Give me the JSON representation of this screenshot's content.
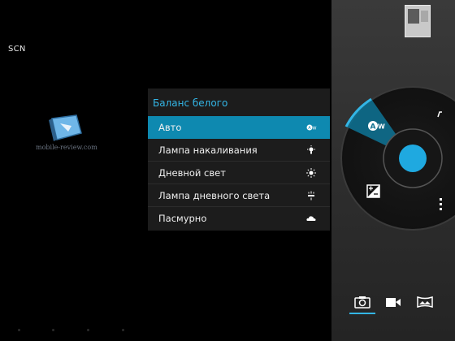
{
  "viewfinder": {
    "scene_label": "SCN",
    "watermark_text": "mobile-review.com"
  },
  "white_balance": {
    "title": "Баланс белого",
    "selected_index": 0,
    "items": [
      {
        "label": "Авто",
        "icon": "auto-wb-icon"
      },
      {
        "label": "Лампа накаливания",
        "icon": "incandescent-icon"
      },
      {
        "label": "Дневной свет",
        "icon": "sun-icon"
      },
      {
        "label": "Лампа дневного света",
        "icon": "fluorescent-icon"
      },
      {
        "label": "Пасмурно",
        "icon": "cloud-icon"
      }
    ]
  },
  "control_wheel": {
    "active_setting_icon": "auto-wb-icon",
    "active_setting_text": "AW",
    "other_icons": [
      "flash-icon",
      "exposure-icon",
      "more-options-icon"
    ],
    "shutter_icon": "shutter-button"
  },
  "mode_bar": {
    "modes": [
      "camera-icon",
      "video-icon",
      "panorama-icon"
    ],
    "selected_mode": "camera-icon"
  },
  "colors": {
    "accent": "#33b5e5",
    "selected_row": "#0e89b0",
    "shutter": "#1fa9e0"
  }
}
